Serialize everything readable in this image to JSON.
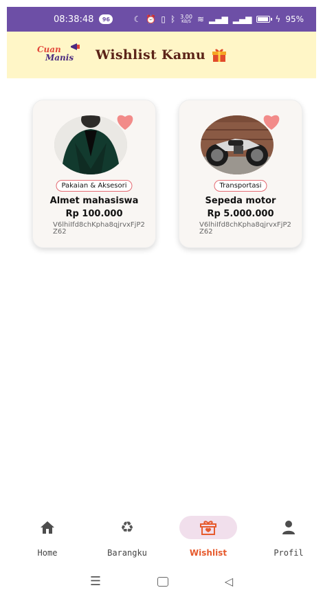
{
  "status_bar": {
    "time": "08:38:48",
    "notification_badge": "96",
    "data_speed": "3.00",
    "data_unit": "KB/S",
    "battery": "95%"
  },
  "header": {
    "logo_line1": "Cuan",
    "logo_line2": "Manis",
    "title": "Wishlist Kamu"
  },
  "items": [
    {
      "category": "Pakaian & Aksesori",
      "name": "Almet mahasiswa",
      "price": "Rp 100.000",
      "id": "V6lhiIfd8chKpha8qjrvxFjP2Z62",
      "favorited": true
    },
    {
      "category": "Transportasi",
      "name": "Sepeda motor",
      "price": "Rp 5.000.000",
      "id": "V6lhiIfd8chKpha8qjrvxFjP2Z62",
      "favorited": true
    }
  ],
  "bottom_nav": [
    {
      "label": "Home",
      "icon": "home-icon",
      "active": false
    },
    {
      "label": "Barangku",
      "icon": "recycle-icon",
      "active": false
    },
    {
      "label": "Wishlist",
      "icon": "gift-box-icon",
      "active": true
    },
    {
      "label": "Profil",
      "icon": "person-icon",
      "active": false
    }
  ],
  "colors": {
    "status_bar": "#6d4fa6",
    "header_bg": "#fff6c7",
    "title": "#5b2318",
    "accent": "#e65a2d",
    "heart": "#f28b89",
    "active_pill": "#f1dfec"
  }
}
